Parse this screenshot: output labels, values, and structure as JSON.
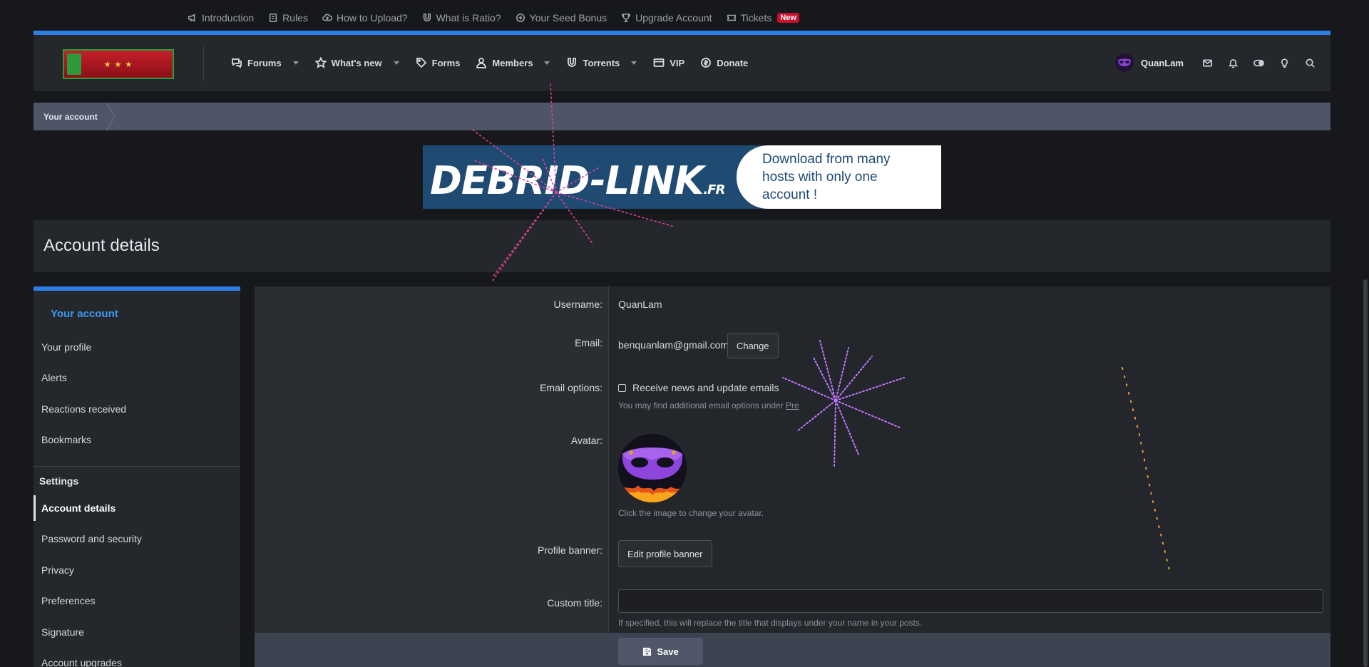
{
  "toplinks": [
    {
      "label": "Introduction",
      "icon": "megaphone-icon"
    },
    {
      "label": "Rules",
      "icon": "document-icon"
    },
    {
      "label": "How to Upload?",
      "icon": "upload-cloud-icon"
    },
    {
      "label": "What is Ratio?",
      "icon": "magnet-icon"
    },
    {
      "label": "Your Seed Bonus",
      "icon": "plus-circle-icon"
    },
    {
      "label": "Upgrade Account",
      "icon": "trophy-icon"
    },
    {
      "label": "Tickets",
      "icon": "ticket-icon",
      "badge": "New"
    }
  ],
  "nav": {
    "items": [
      {
        "label": "Forums",
        "icon": "chat-icon",
        "dropdown": true
      },
      {
        "label": "What's new",
        "icon": "star-icon",
        "dropdown": true
      },
      {
        "label": "Forms",
        "icon": "tag-icon",
        "dropdown": false
      },
      {
        "label": "Members",
        "icon": "user-icon",
        "dropdown": true
      },
      {
        "label": "Torrents",
        "icon": "magnet-icon",
        "dropdown": true
      },
      {
        "label": "VIP",
        "icon": "card-icon",
        "dropdown": false
      },
      {
        "label": "Donate",
        "icon": "donate-icon",
        "dropdown": false
      }
    ],
    "username": "QuanLam"
  },
  "breadcrumb": {
    "label": "Your account"
  },
  "ad": {
    "brand": "DEBRID-LINK",
    "brand_suffix": ".FR",
    "tagline": "Download from many hosts with only one account !"
  },
  "page": {
    "title": "Account details"
  },
  "sidebar": {
    "heading": "Your account",
    "items": [
      "Your profile",
      "Alerts",
      "Reactions received",
      "Bookmarks"
    ],
    "settings_label": "Settings",
    "settings_items": [
      "Account details",
      "Password and security",
      "Privacy",
      "Preferences",
      "Signature",
      "Account upgrades"
    ],
    "active": "Account details"
  },
  "form": {
    "username_label": "Username:",
    "username_value": "QuanLam",
    "email_label": "Email:",
    "email_value": "benquanlam@gmail.com",
    "change_button": "Change",
    "email_options_label": "Email options:",
    "newsletter_label": "Receive news and update emails",
    "newsletter_checked": false,
    "email_options_hint": "You may find additional email options under ",
    "email_options_hint_link": "Pre",
    "avatar_label": "Avatar:",
    "avatar_hint": "Click the image to change your avatar.",
    "profile_banner_label": "Profile banner:",
    "profile_banner_button": "Edit profile banner",
    "custom_title_label": "Custom title:",
    "custom_title_value": "",
    "custom_title_hint": "If specified, this will replace the title that displays under your name in your posts.",
    "save_button": "Save"
  },
  "colors": {
    "accent": "#2f7ee6",
    "badge_red": "#c8102e",
    "sidebar_heading": "#3c98ef",
    "crumb_bar": "#4d5566"
  }
}
